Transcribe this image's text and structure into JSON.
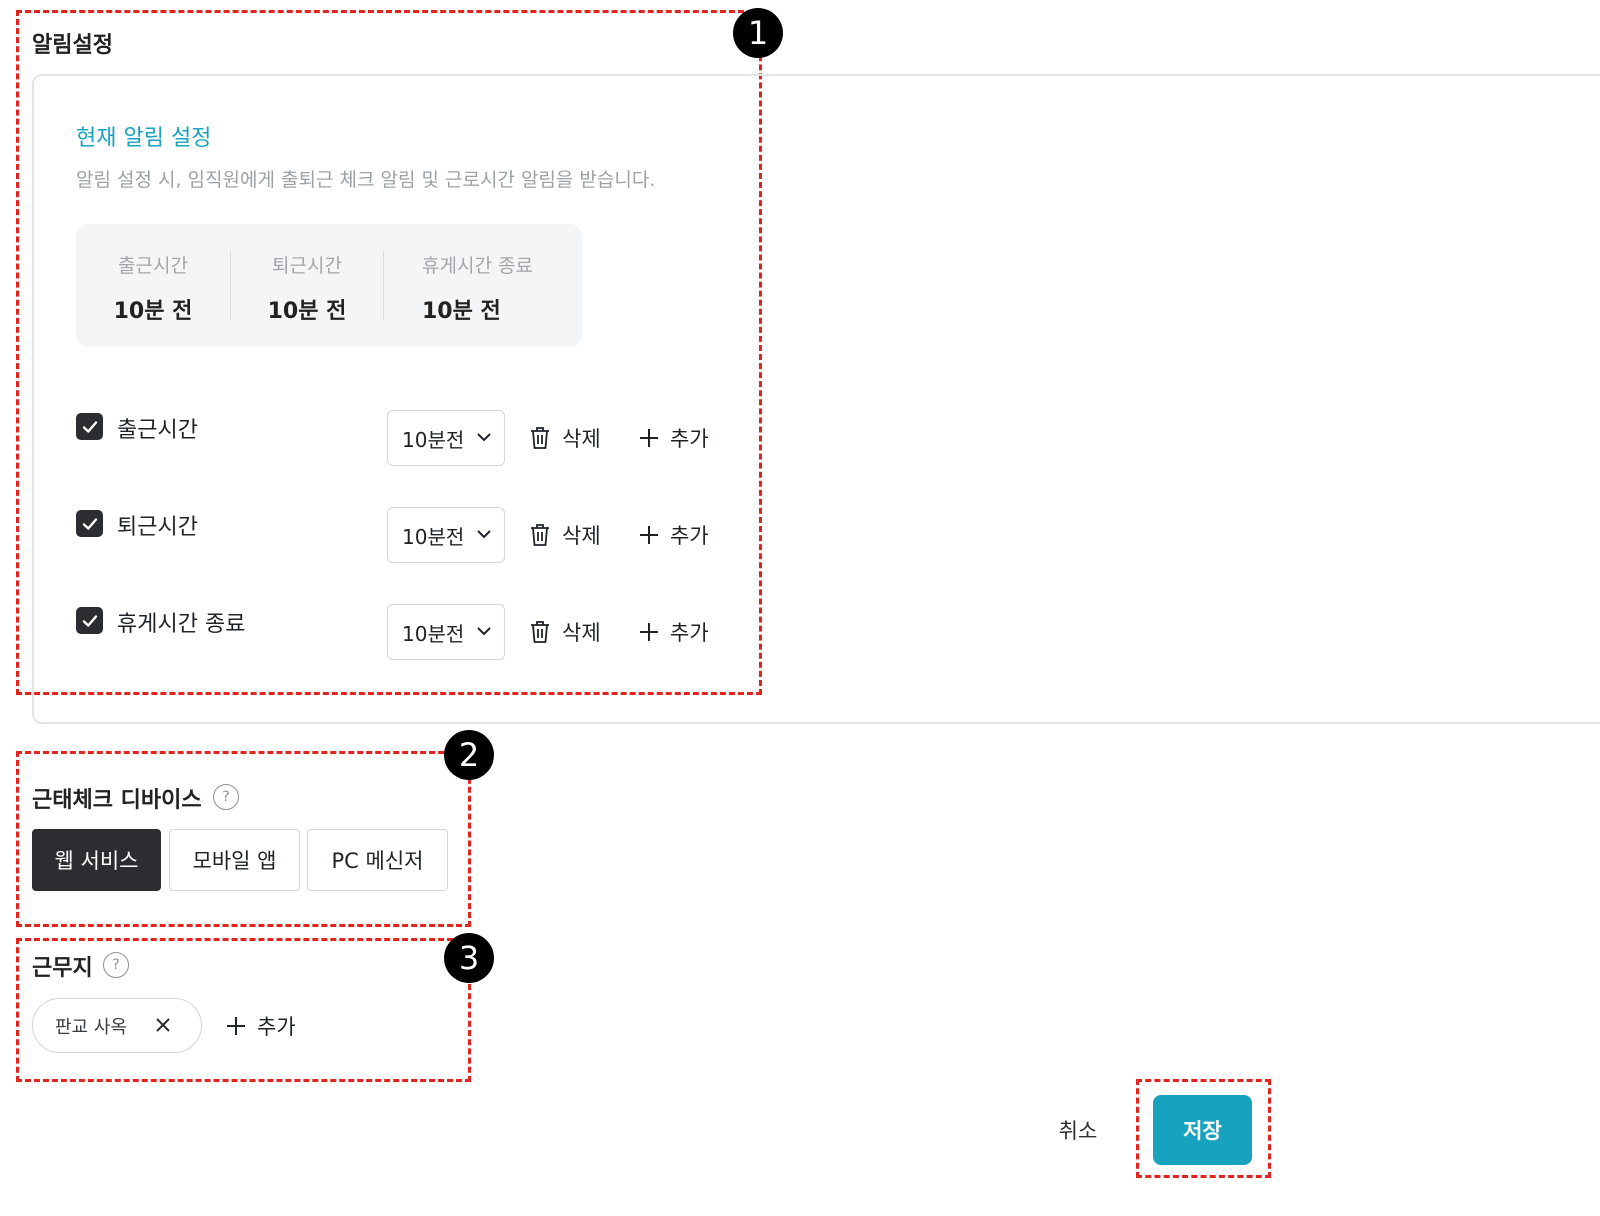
{
  "alarm": {
    "section_title": "알림설정",
    "current_title": "현재 알림 설정",
    "current_desc": "알림 설정 시, 임직원에게 출퇴근 체크 알림 및 근로시간 알림을 받습니다.",
    "summary": [
      {
        "label": "출근시간",
        "value": "10분 전"
      },
      {
        "label": "퇴근시간",
        "value": "10분 전"
      },
      {
        "label": "휴게시간 종료",
        "value": "10분 전"
      }
    ],
    "rows": [
      {
        "label": "출근시간",
        "checked": true,
        "select": "10분전",
        "delete": "삭제",
        "add": "추가"
      },
      {
        "label": "퇴근시간",
        "checked": true,
        "select": "10분전",
        "delete": "삭제",
        "add": "추가"
      },
      {
        "label": "휴게시간 종료",
        "checked": true,
        "select": "10분전",
        "delete": "삭제",
        "add": "추가"
      }
    ]
  },
  "device": {
    "title": "근태체크 디바이스",
    "help": "?",
    "options": [
      {
        "label": "웹 서비스",
        "active": true
      },
      {
        "label": "모바일 앱",
        "active": false
      },
      {
        "label": "PC 메신저",
        "active": false
      }
    ]
  },
  "workplace": {
    "title": "근무지",
    "help": "?",
    "chips": [
      {
        "label": "판교 사옥"
      }
    ],
    "add": "추가"
  },
  "footer": {
    "cancel": "취소",
    "save": "저장"
  },
  "markers": [
    "1",
    "2",
    "3"
  ],
  "colors": {
    "accent": "#17a3c0",
    "annotation": "#e3231c",
    "dark": "#2b2d31"
  }
}
